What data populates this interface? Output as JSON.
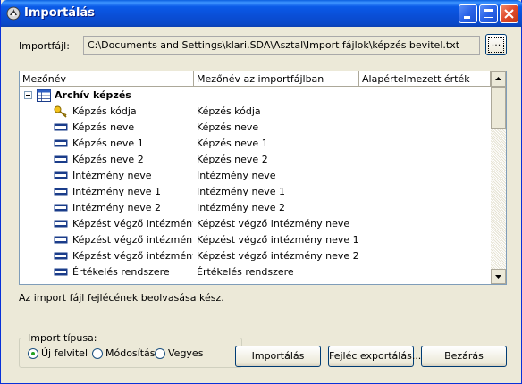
{
  "window": {
    "title": "Importálás",
    "icon": "app-icon"
  },
  "import_file": {
    "label": "Importfájl:",
    "path": "C:\\Documents and Settings\\klari.SDA\\Asztal\\Import fájlok\\képzés bevitel.txt",
    "browse_label": "..."
  },
  "tree": {
    "columns": [
      "Mezőnév",
      "Mezőnév az importfájlban",
      "Alapértelmezett érték"
    ],
    "root": {
      "expander": "−",
      "label": "Archív képzés",
      "icon": "table-icon"
    },
    "rows": [
      {
        "name": "Képzés kódja",
        "import_name": "Képzés kódja",
        "default": "",
        "icon": "key-icon"
      },
      {
        "name": "Képzés neve",
        "import_name": "Képzés neve",
        "default": "",
        "icon": "field-icon"
      },
      {
        "name": "Képzés neve 1",
        "import_name": "Képzés neve 1",
        "default": "",
        "icon": "field-icon"
      },
      {
        "name": "Képzés neve 2",
        "import_name": "Képzés neve 2",
        "default": "",
        "icon": "field-icon"
      },
      {
        "name": "Intézmény neve",
        "import_name": "Intézmény neve",
        "default": "",
        "icon": "field-icon"
      },
      {
        "name": "Intézmény neve 1",
        "import_name": "Intézmény neve 1",
        "default": "",
        "icon": "field-icon"
      },
      {
        "name": "Intézmény neve 2",
        "import_name": "Intézmény neve 2",
        "default": "",
        "icon": "field-icon"
      },
      {
        "name": "Képzést végző intézmény ne",
        "import_name": "Képzést végző intézmény neve",
        "default": "",
        "icon": "field-icon"
      },
      {
        "name": "Képzést végző intézmény ne",
        "import_name": "Képzést végző intézmény neve 1",
        "default": "",
        "icon": "field-icon"
      },
      {
        "name": "Képzést végző intézmény ne",
        "import_name": "Képzést végző intézmény neve 2",
        "default": "",
        "icon": "field-icon"
      },
      {
        "name": "Értékelés rendszere",
        "import_name": "Értékelés rendszere",
        "default": "",
        "icon": "field-icon"
      }
    ]
  },
  "status_text": "Az import fájl fejlécének beolvasása kész.",
  "import_type": {
    "label": "Import típusa:",
    "options": [
      {
        "label": "Új felvitel",
        "selected": true
      },
      {
        "label": "Módosítás",
        "selected": false
      },
      {
        "label": "Vegyes",
        "selected": false
      }
    ]
  },
  "buttons": {
    "import": "Importálás",
    "export_header": "Fejléc exportálás...",
    "close": "Bezárás"
  },
  "colors": {
    "titlebar": "#0a4ed6",
    "window_bg": "#ece9d8",
    "close_button": "#e0492a"
  }
}
